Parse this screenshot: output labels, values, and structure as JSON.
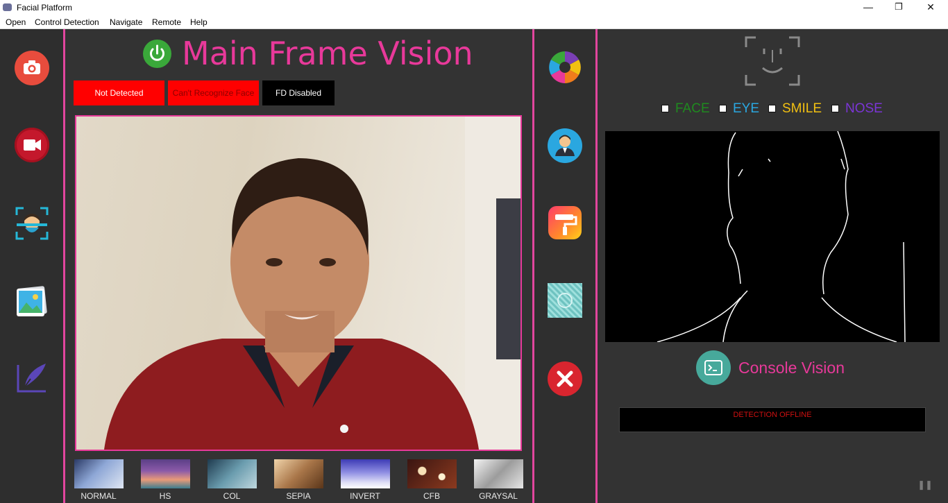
{
  "window": {
    "title": "Facial Platform",
    "minimize_glyph": "—",
    "maximize_glyph": "❐",
    "close_glyph": "✕"
  },
  "menu": [
    "Open",
    "Control Detection",
    "Navigate",
    "Remote",
    "Help"
  ],
  "left_tools": [
    {
      "icon": "camera-icon",
      "color": "#e84c3d"
    },
    {
      "icon": "video-camera-icon",
      "color": "#c4182c"
    },
    {
      "icon": "face-scan-icon",
      "color": "#25b8d8"
    },
    {
      "icon": "image-gallery-icon",
      "color": "#3fb3e6"
    },
    {
      "icon": "quill-document-icon",
      "color": "#5b46b8"
    }
  ],
  "main": {
    "title": "Main Frame Vision",
    "power_color": "#3aa83a",
    "status": [
      {
        "text": "Not Detected",
        "bg": "#ff0000",
        "fg": "#ffffff"
      },
      {
        "text": "Can't Recognize Face",
        "bg": "#ff0000",
        "fg": "#8a0000"
      },
      {
        "text": "FD Disabled",
        "bg": "#000000",
        "fg": "#ffffff"
      }
    ],
    "filters": [
      "NORMAL",
      "HS",
      "COL",
      "SEPIA",
      "INVERT",
      "CFB",
      "GRAYSAL"
    ]
  },
  "mid_tools": [
    {
      "icon": "color-wheel-icon"
    },
    {
      "icon": "user-profile-icon"
    },
    {
      "icon": "paint-roller-icon"
    },
    {
      "icon": "pattern-tile-icon"
    },
    {
      "icon": "close-app-icon"
    }
  ],
  "right": {
    "detections": [
      {
        "label": "FACE",
        "color": "#1f8a1f"
      },
      {
        "label": "EYE",
        "color": "#2aa7e0"
      },
      {
        "label": "SMILE",
        "color": "#f2c012"
      },
      {
        "label": "NOSE",
        "color": "#7b35d6"
      }
    ],
    "console_title": "Console Vision",
    "console_text": "DETECTION OFFLINE",
    "pause_glyph": "❚❚"
  }
}
